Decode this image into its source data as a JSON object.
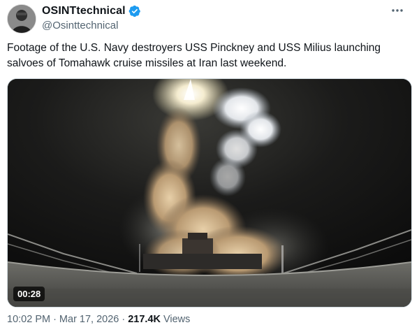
{
  "author": {
    "display_name": "OSINTtechnical",
    "handle": "@Osinttechnical",
    "verified_color": "#1d9bf0"
  },
  "tweet": {
    "text_line1": "Footage of the U.S. Navy destroyers USS Pinckney and USS Milius launching",
    "text_line2": "salvoes of Tomahawk cruise missiles at Iran last weekend."
  },
  "media": {
    "duration": "00:28",
    "scene": "night missile launch from destroyer deck"
  },
  "meta": {
    "time": "10:02 PM",
    "separator": "·",
    "date": "Mar 17, 2026",
    "views_count": "217.4K",
    "views_label": "Views"
  },
  "icons": {
    "verified": "verified-badge-icon",
    "more": "more-options-icon"
  }
}
